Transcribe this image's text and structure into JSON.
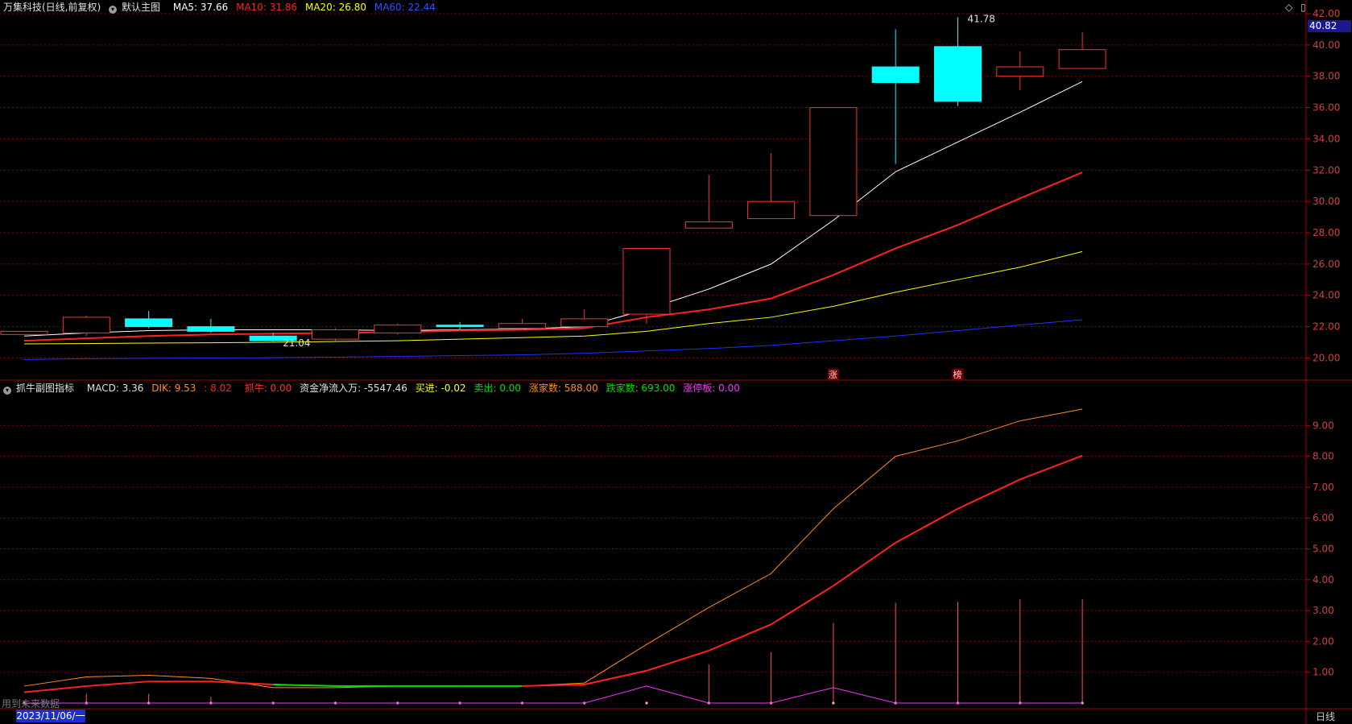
{
  "main_header": {
    "stock": "万集科技(日线,前复权)",
    "indicator_name": "默认主图",
    "ma5": "MA5: 37.66",
    "ma10": "MA10: 31.86",
    "ma20": "MA20: 26.80",
    "ma60": "MA60: 22.44"
  },
  "sub_header": {
    "indicator_name": "抓牛副图指标",
    "macd": "MACD: 3.36",
    "dik": "DIK: 9.53",
    "dik2": ": 8.02",
    "zhuaniu": "抓牛: 0.00",
    "fund": "资金净流入万: -5547.46",
    "buy": "买进: -0.02",
    "sell": "卖出: 0.00",
    "up_count": "涨家数: 588.00",
    "down_count": "跌家数: 693.00",
    "limit_up": "涨停板: 0.00"
  },
  "colors": {
    "ma5": "#ffffff",
    "ma10": "#ff2020",
    "ma20": "#ffff00",
    "ma60": "#2030ff",
    "up": "#ff3030",
    "down": "#00ffff",
    "grid": "#8b0000",
    "dik": "#ff8c1a",
    "dik2": "#ff2020",
    "magenta": "#ff30ff",
    "green": "#00e000",
    "orange": "#ff8c1a"
  },
  "price_tag": "40.82",
  "footer": {
    "date": "2023/11/06/一",
    "period": "日线",
    "future": "用到未来数据"
  },
  "top_icons": [
    "diamond-icon",
    "window-icon"
  ],
  "chart_data": [
    {
      "type": "candlestick",
      "ylim": [
        19.2,
        42
      ],
      "y_ticks": [
        "42.00",
        "40.00",
        "38.00",
        "36.00",
        "34.00",
        "32.00",
        "30.00",
        "28.00",
        "26.00",
        "24.00",
        "22.00",
        "20.00"
      ],
      "candles": [
        {
          "open": 21.5,
          "close": 21.7,
          "high": 21.7,
          "low": 21.5
        },
        {
          "open": 21.6,
          "close": 22.6,
          "high": 22.7,
          "low": 21.4
        },
        {
          "open": 22.5,
          "close": 22.0,
          "high": 23.0,
          "low": 21.9
        },
        {
          "open": 22.0,
          "close": 21.7,
          "high": 22.5,
          "low": 21.6
        },
        {
          "open": 21.4,
          "close": 21.1,
          "high": 21.6,
          "low": 21.04
        },
        {
          "open": 21.2,
          "close": 21.8,
          "high": 21.9,
          "low": 21.1
        },
        {
          "open": 21.6,
          "close": 22.1,
          "high": 22.2,
          "low": 21.5
        },
        {
          "open": 22.1,
          "close": 22.0,
          "high": 22.3,
          "low": 21.8
        },
        {
          "open": 21.9,
          "close": 22.2,
          "high": 22.5,
          "low": 21.8
        },
        {
          "open": 22.0,
          "close": 22.5,
          "high": 23.1,
          "low": 21.9
        },
        {
          "open": 22.8,
          "close": 27.0,
          "high": 27.0,
          "low": 22.2
        },
        {
          "open": 28.3,
          "close": 28.7,
          "high": 31.7,
          "low": 28.3
        },
        {
          "open": 28.9,
          "close": 30.0,
          "high": 33.1,
          "low": 28.9
        },
        {
          "open": 29.1,
          "close": 36.0,
          "high": 36.0,
          "low": 29.1
        },
        {
          "open": 38.6,
          "close": 37.6,
          "high": 41.0,
          "low": 32.4
        },
        {
          "open": 39.9,
          "close": 36.4,
          "high": 41.78,
          "low": 36.1
        },
        {
          "open": 38.0,
          "close": 38.6,
          "high": 39.6,
          "low": 37.1
        },
        {
          "open": 38.5,
          "close": 39.7,
          "high": 40.8,
          "low": 38.5
        }
      ],
      "series": [
        {
          "name": "MA5",
          "values": [
            21.4,
            21.6,
            21.75,
            21.8,
            21.8,
            21.8,
            21.75,
            21.8,
            21.85,
            22.0,
            23.1,
            24.4,
            26.0,
            28.8,
            31.9,
            33.8,
            35.7,
            37.66
          ]
        },
        {
          "name": "MA10",
          "values": [
            21.1,
            21.25,
            21.4,
            21.5,
            21.55,
            21.6,
            21.65,
            21.75,
            21.8,
            21.9,
            22.6,
            23.1,
            23.8,
            25.3,
            27.0,
            28.5,
            30.2,
            31.86
          ]
        },
        {
          "name": "MA20",
          "values": [
            20.9,
            20.92,
            20.95,
            20.97,
            21.0,
            21.05,
            21.1,
            21.2,
            21.3,
            21.4,
            21.7,
            22.2,
            22.6,
            23.3,
            24.2,
            25.0,
            25.8,
            26.8
          ]
        },
        {
          "name": "MA60",
          "values": [
            19.9,
            19.95,
            19.98,
            20.0,
            20.02,
            20.05,
            20.1,
            20.15,
            20.2,
            20.3,
            20.45,
            20.6,
            20.8,
            21.1,
            21.4,
            21.75,
            22.1,
            22.44
          ]
        }
      ],
      "annotations": [
        {
          "label": "41.78",
          "x_index": 15,
          "value": 41.78
        },
        {
          "label": "21.04",
          "x_index": 4,
          "value": 21.04
        }
      ],
      "markers": [
        {
          "label": "涨",
          "x_index": 13
        },
        {
          "label": "榜",
          "x_index": 15
        }
      ]
    },
    {
      "type": "line",
      "ylim": [
        0,
        10
      ],
      "y_ticks": [
        "9.00",
        "8.00",
        "7.00",
        "6.00",
        "5.00",
        "4.00",
        "3.00",
        "2.00",
        "1.00"
      ],
      "series": [
        {
          "name": "DIK",
          "values": [
            0.55,
            0.85,
            0.9,
            0.8,
            0.5,
            0.5,
            0.55,
            0.55,
            0.55,
            0.65,
            1.9,
            3.1,
            4.2,
            6.3,
            8.0,
            8.5,
            9.15,
            9.53
          ]
        },
        {
          "name": "DIK2",
          "values": [
            0.35,
            0.55,
            0.7,
            0.7,
            0.6,
            0.55,
            0.55,
            0.55,
            0.55,
            0.6,
            1.05,
            1.7,
            2.55,
            3.8,
            5.2,
            6.3,
            7.25,
            8.02
          ]
        },
        {
          "name": "抓牛",
          "values": [
            0,
            0,
            0,
            0,
            0,
            0,
            0,
            0,
            0,
            0,
            0.55,
            0,
            0,
            0.5,
            0,
            0,
            0,
            0
          ]
        },
        {
          "name": "MACD",
          "values": [
            0,
            0.3,
            0.3,
            0.2,
            0,
            0,
            0,
            0,
            0,
            0,
            0,
            1.25,
            1.65,
            2.6,
            3.25,
            3.28,
            3.36,
            3.36
          ]
        }
      ]
    }
  ]
}
